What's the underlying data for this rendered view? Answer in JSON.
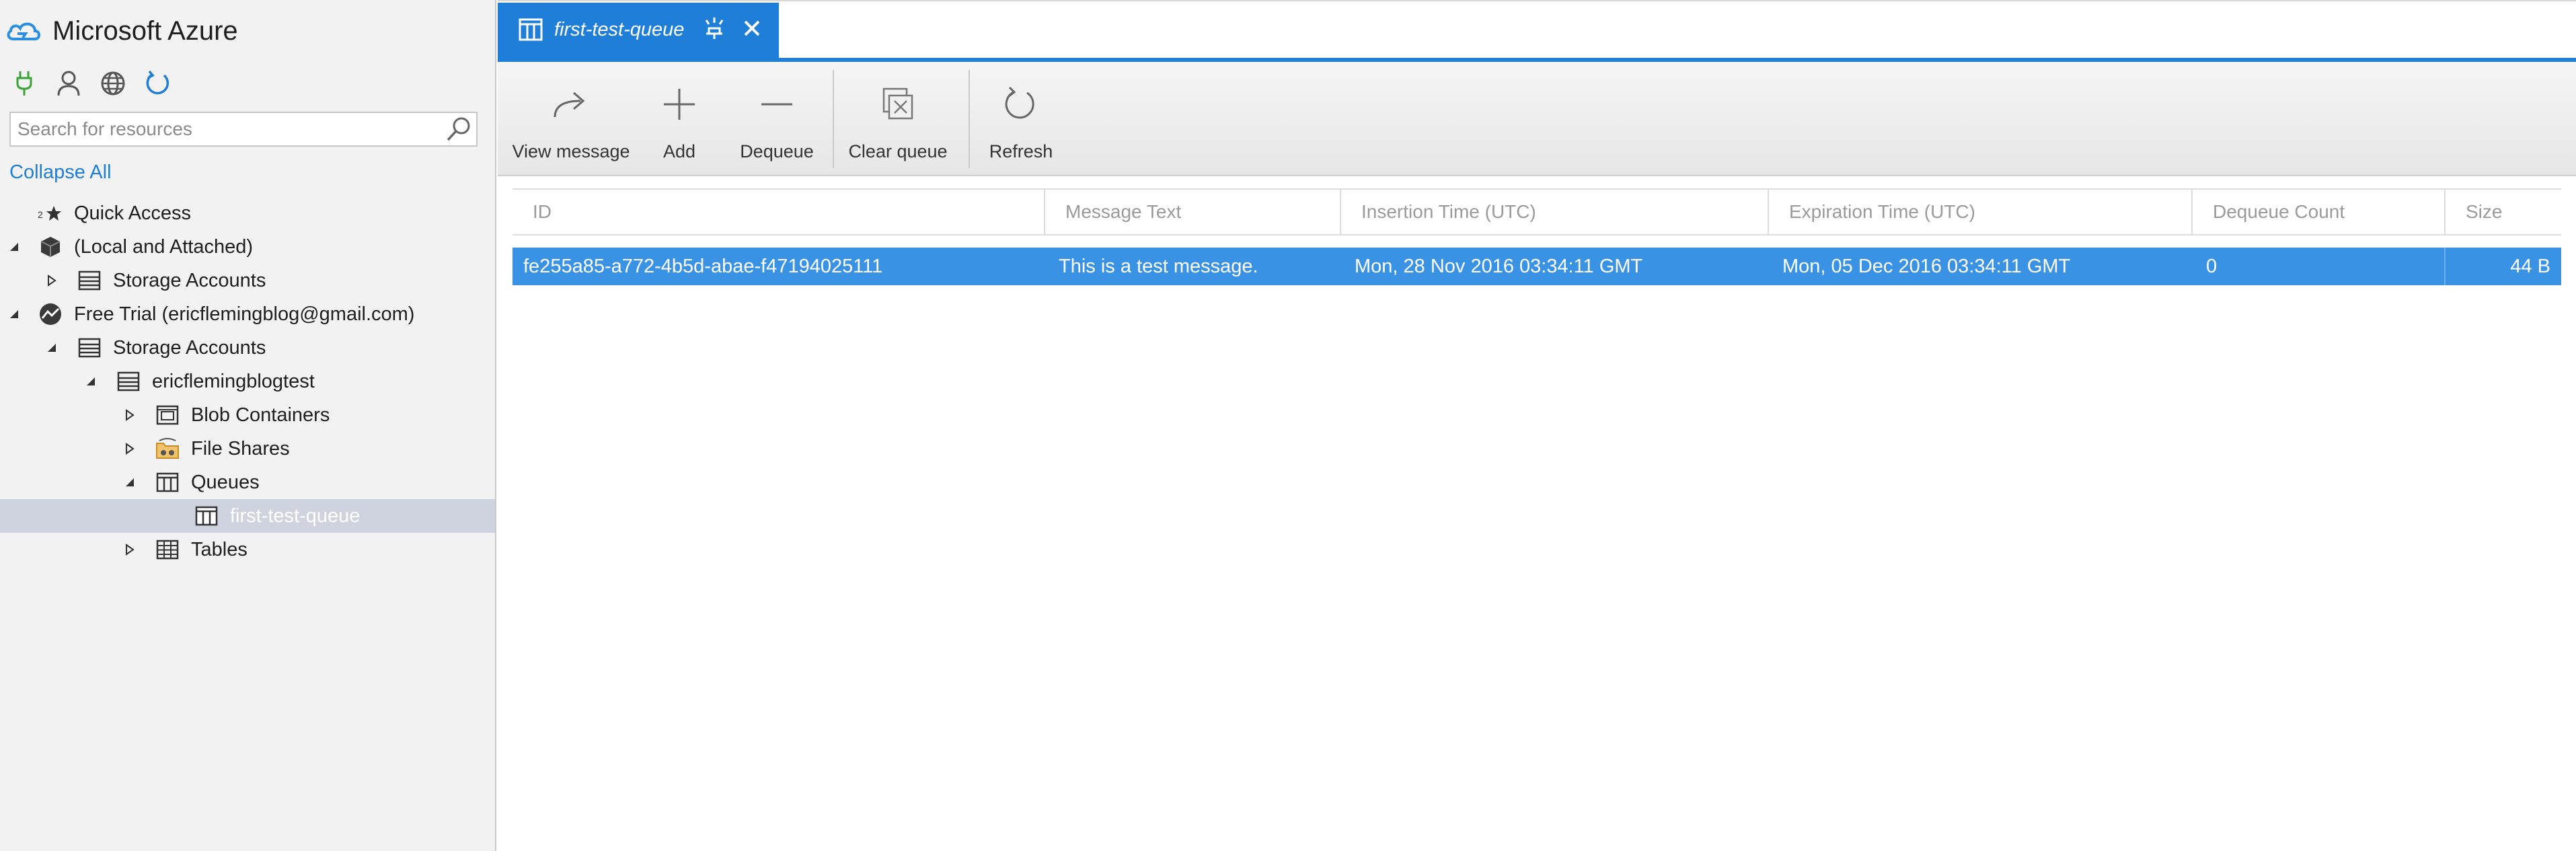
{
  "app": {
    "title": "Microsoft Azure"
  },
  "sidebar": {
    "toolbar": [
      {
        "name": "connect-plug-icon",
        "color": "#3aa335"
      },
      {
        "name": "account-icon",
        "color": "#555555"
      },
      {
        "name": "globe-icon",
        "color": "#555555"
      },
      {
        "name": "refresh-icon",
        "color": "#1e7ed8"
      }
    ],
    "search": {
      "placeholder": "Search for resources",
      "value": ""
    },
    "collapse_all": "Collapse All",
    "tree": [
      {
        "label": "Quick Access",
        "icon": "quick-access-icon",
        "expander": "none"
      },
      {
        "label": "(Local and Attached)",
        "icon": "cube-icon",
        "expander": "expanded"
      },
      {
        "label": "Storage Accounts",
        "icon": "storage-accounts-icon",
        "expander": "collapsed"
      },
      {
        "label": "Free Trial (ericflemingblog@gmail.com)",
        "icon": "subscription-icon",
        "expander": "expanded"
      },
      {
        "label": "Storage Accounts",
        "icon": "storage-accounts-icon",
        "expander": "expanded"
      },
      {
        "label": "ericflemingblogtest",
        "icon": "storage-account-icon",
        "expander": "expanded"
      },
      {
        "label": "Blob Containers",
        "icon": "blob-container-icon",
        "expander": "collapsed"
      },
      {
        "label": "File Shares",
        "icon": "file-share-icon",
        "expander": "collapsed"
      },
      {
        "label": "Queues",
        "icon": "queue-icon",
        "expander": "expanded"
      },
      {
        "label": "first-test-queue",
        "icon": "queue-icon",
        "expander": "none",
        "selected": true
      },
      {
        "label": "Tables",
        "icon": "table-icon",
        "expander": "collapsed"
      }
    ]
  },
  "tab": {
    "label": "first-test-queue"
  },
  "toolbar": {
    "view_message": "View message",
    "add": "Add",
    "dequeue": "Dequeue",
    "clear_queue": "Clear queue",
    "refresh": "Refresh"
  },
  "grid": {
    "columns": [
      "ID",
      "Message Text",
      "Insertion Time (UTC)",
      "Expiration Time (UTC)",
      "Dequeue Count",
      "Size"
    ],
    "rows": [
      {
        "id": "fe255a85-a772-4b5d-abae-f47194025111",
        "message_text": "This is a test message.",
        "insertion_time": "Mon, 28 Nov 2016 03:34:11 GMT",
        "expiration_time": "Mon, 05 Dec 2016 03:34:11 GMT",
        "dequeue_count": "0",
        "size": "44 B"
      }
    ]
  },
  "colors": {
    "accent": "#1e7ed8",
    "selected_row": "#3a92e4",
    "selected_tree": "#cfd3e0"
  }
}
